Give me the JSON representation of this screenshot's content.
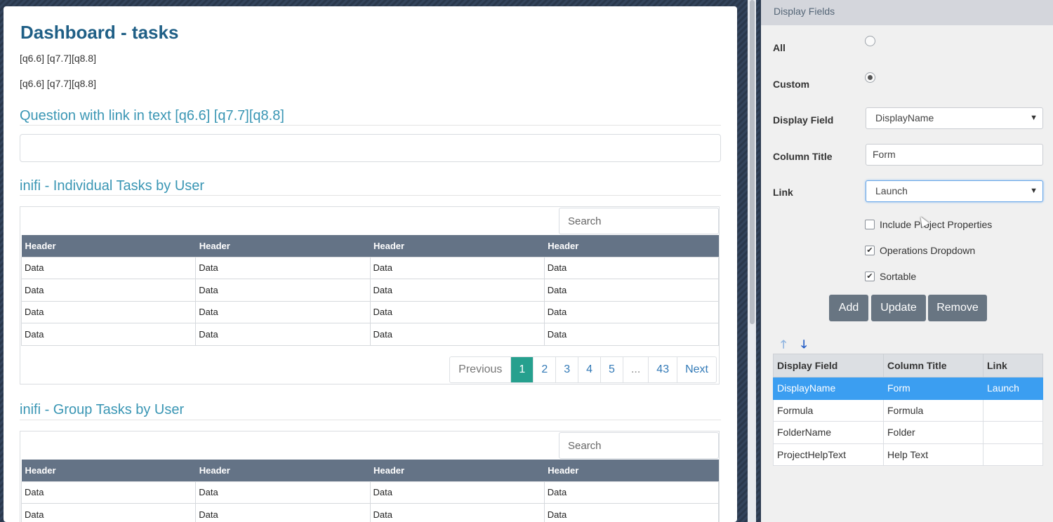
{
  "main": {
    "title": "Dashboard - tasks",
    "codes_line1": "[q6.6] [q7.7][q8.8]",
    "codes_line2": "[q6.6] [q7.7][q8.8]",
    "question_title": "Question with link in text [q6.6] [q7.7][q8.8]",
    "sections": [
      {
        "title": "inifi - Individual Tasks by User",
        "search_placeholder": "Search",
        "headers": [
          "Header",
          "Header",
          "Header",
          "Header"
        ],
        "rows": [
          [
            "Data",
            "Data",
            "Data",
            "Data"
          ],
          [
            "Data",
            "Data",
            "Data",
            "Data"
          ],
          [
            "Data",
            "Data",
            "Data",
            "Data"
          ],
          [
            "Data",
            "Data",
            "Data",
            "Data"
          ]
        ],
        "pager": [
          "Previous",
          "1",
          "2",
          "3",
          "4",
          "5",
          "...",
          "43",
          "Next"
        ],
        "active_page": "1"
      },
      {
        "title": "inifi - Group Tasks by User",
        "search_placeholder": "Search",
        "headers": [
          "Header",
          "Header",
          "Header",
          "Header"
        ],
        "rows": [
          [
            "Data",
            "Data",
            "Data",
            "Data"
          ],
          [
            "Data",
            "Data",
            "Data",
            "Data"
          ]
        ]
      }
    ]
  },
  "side": {
    "header": "Display Fields",
    "all_label": "All",
    "custom_label": "Custom",
    "selected_radio": "Custom",
    "display_field_label": "Display Field",
    "display_field_value": "DisplayName",
    "column_title_label": "Column Title",
    "column_title_value": "Form",
    "link_label": "Link",
    "link_value": "Launch",
    "checkboxes": [
      {
        "label": "Include Project Properties",
        "checked": false
      },
      {
        "label": "Operations Dropdown",
        "checked": true
      },
      {
        "label": "Sortable",
        "checked": true
      }
    ],
    "buttons": {
      "add": "Add",
      "update": "Update",
      "remove": "Remove"
    },
    "grid_headers": [
      "Display Field",
      "Column Title",
      "Link"
    ],
    "grid_rows": [
      [
        "DisplayName",
        "Form",
        "Launch"
      ],
      [
        "Formula",
        "Formula",
        ""
      ],
      [
        "FolderName",
        "Folder",
        ""
      ],
      [
        "ProjectHelpText",
        "Help Text",
        ""
      ]
    ],
    "selected_row": 0
  },
  "colors": {
    "title": "#1f5f86",
    "section_title": "#3a96b4",
    "table_header": "#647386",
    "pager_active": "#26a08e",
    "selected_row": "#3b9ef1",
    "button": "#687582"
  },
  "icons": [
    "arrow-up-icon",
    "arrow-down-icon",
    "radio-icon",
    "checkbox-icon",
    "dropdown-caret-icon"
  ]
}
